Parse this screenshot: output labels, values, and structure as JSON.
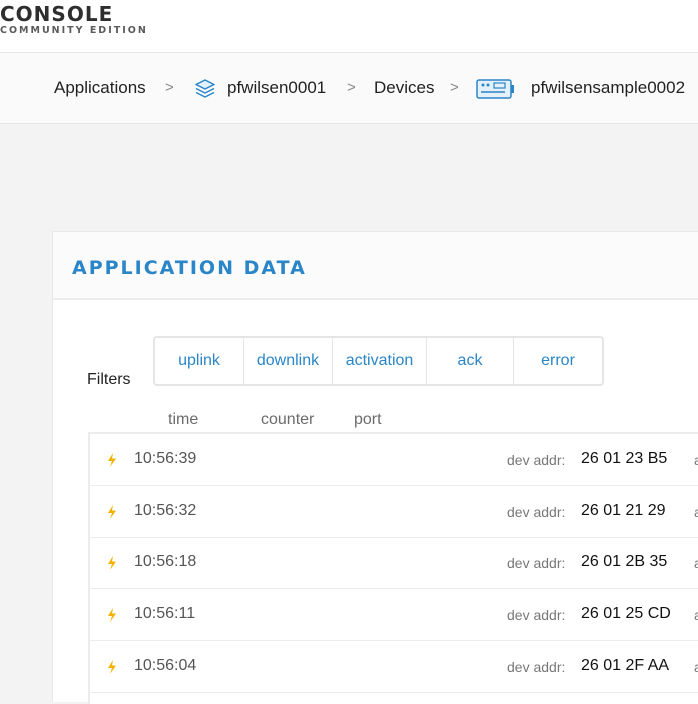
{
  "logo": {
    "title": "CONSOLE",
    "subtitle": "COMMUNITY EDITION"
  },
  "breadcrumb": {
    "items": [
      {
        "label": "Applications"
      },
      {
        "label": "pfwilsen0001",
        "icon": "stack-layers-icon"
      },
      {
        "label": "Devices"
      },
      {
        "label": "pfwilsensample0002",
        "icon": "device-board-icon"
      }
    ],
    "separator": ">"
  },
  "card": {
    "title": "APPLICATION DATA"
  },
  "filters": {
    "label": "Filters",
    "options": [
      "uplink",
      "downlink",
      "activation",
      "ack",
      "error"
    ]
  },
  "columns": [
    "time",
    "counter",
    "port"
  ],
  "rows": [
    {
      "time": "10:56:39",
      "label": "dev addr:",
      "addr": "26 01 23 B5",
      "extra": "a"
    },
    {
      "time": "10:56:32",
      "label": "dev addr:",
      "addr": "26 01 21 29",
      "extra": "a"
    },
    {
      "time": "10:56:18",
      "label": "dev addr:",
      "addr": "26 01 2B 35",
      "extra": "a"
    },
    {
      "time": "10:56:11",
      "label": "dev addr:",
      "addr": "26 01 25 CD",
      "extra": "a"
    },
    {
      "time": "10:56:04",
      "label": "dev addr:",
      "addr": "26 01 2F AA",
      "extra": "a"
    }
  ],
  "colors": {
    "accent": "#2a86c8",
    "bolt": "#f2b200",
    "background": "#f3f3f3"
  }
}
